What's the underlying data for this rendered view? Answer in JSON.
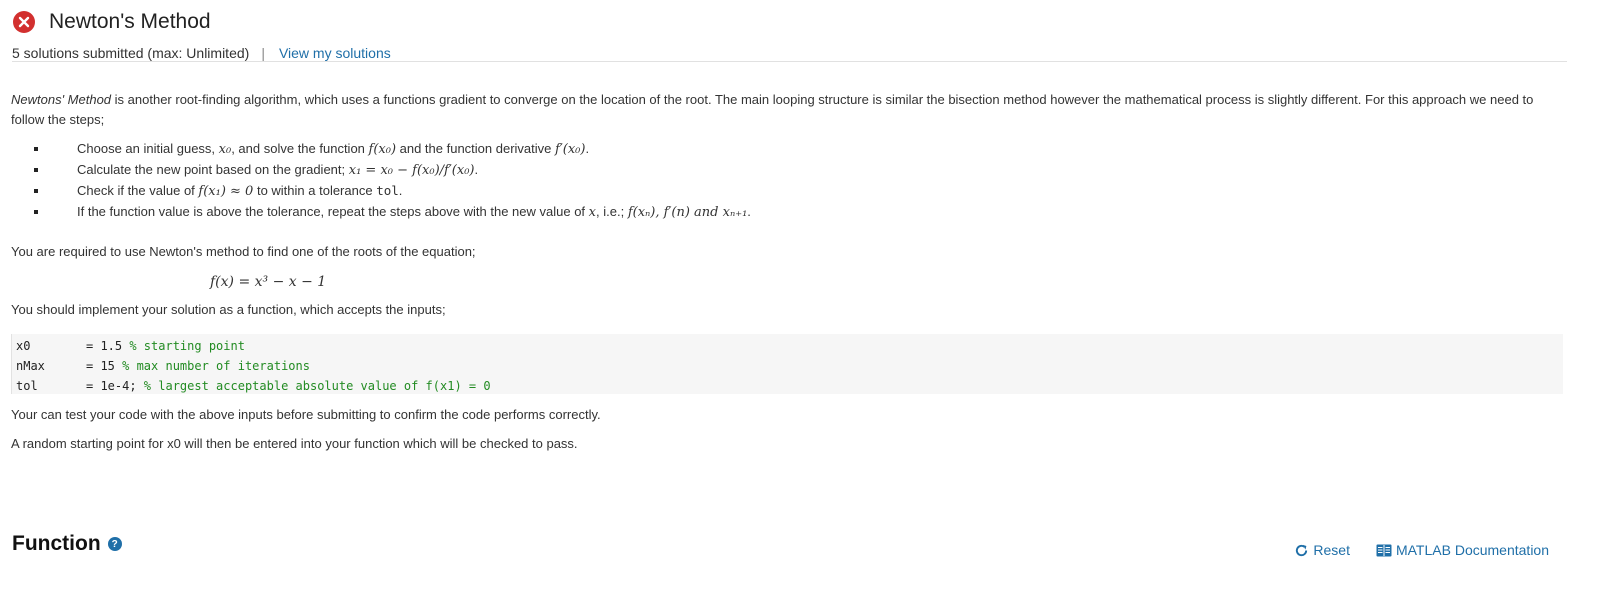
{
  "header": {
    "status_icon": "error-x-circle-icon",
    "title": "Newton's Method",
    "submissions": "5 solutions submitted (max: Unlimited)",
    "separator": "|",
    "view_solutions": "View my solutions"
  },
  "description": {
    "intro_em": "Newtons' Method",
    "intro_rest": " is another root-finding algorithm, which uses a functions gradient to converge on the location of the root. The main looping structure is similar the bisection method however the mathematical process is slightly different. For this approach we need to follow the steps;",
    "steps": [
      {
        "t1": "Choose an initial guess, ",
        "m1": "x₀",
        "t2": ", and solve the function ",
        "m2": "f(x₀)",
        "t3": " and the function derivative ",
        "m3": "f′(x₀)",
        "t4": "."
      },
      {
        "t1": "Calculate the new point based on the gradient; ",
        "m1": "x₁ = x₀ − f(x₀)/f′(x₀)",
        "t2": "."
      },
      {
        "t1": "Check if the value of ",
        "m1": "f(x₁) ≈ 0",
        "t2": " to within a tolerance ",
        "code": "tol",
        "t3": "."
      },
      {
        "t1": " If the function value is above the tolerance, repeat the steps above with the new value of ",
        "m1": "x",
        "t2": ", i.e.; ",
        "m2": "f(xₙ), f′(n) and xₙ₊₁",
        "t3": "."
      }
    ],
    "required": "You are required to use Newton's method to find one of the roots of the equation;",
    "equation": "f(x) = x³ − x − 1",
    "implement": "You should implement your solution as a function, which accepts the inputs;",
    "code_lines": [
      {
        "name": "x0",
        "value": "= 1.5 ",
        "comment": "% starting point"
      },
      {
        "name": "nMax",
        "value": "= 15 ",
        "comment": "% max number of iterations"
      },
      {
        "name": "tol",
        "value": "= 1e-4; ",
        "comment": "% largest acceptable absolute value of f(x1) = 0"
      }
    ],
    "test_note": "Your can test your code with the above inputs before submitting to confirm the code performs correctly.",
    "random_note": "A random starting point for x0 will then be entered into your function which will be checked to pass."
  },
  "function_section": {
    "title": "Function",
    "help_icon": "question-circle-icon",
    "reset_label": "Reset",
    "reset_icon": "refresh-icon",
    "docs_label": "MATLAB Documentation",
    "docs_icon": "book-icon"
  },
  "colors": {
    "link": "#1f6fa8",
    "error": "#d2302f",
    "code_comment": "#228b22",
    "code_bg": "#f6f6f6"
  }
}
